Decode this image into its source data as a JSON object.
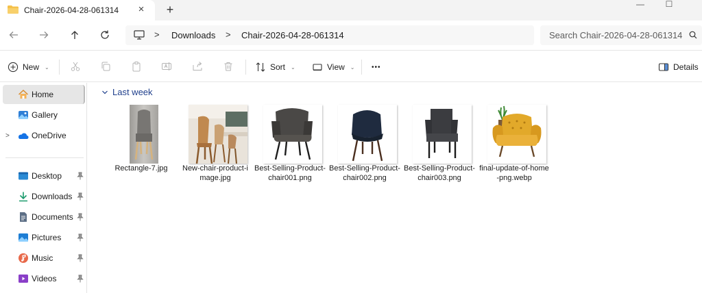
{
  "window": {
    "tab_title": "Chair-2026-04-28-061314",
    "tab_close": "×",
    "new_tab": "+",
    "minimize": "—",
    "maximize": "☐"
  },
  "address_bar": {
    "crumbs": [
      "Downloads",
      "Chair-2026-04-28-061314"
    ],
    "separator": ">"
  },
  "search": {
    "placeholder": "Search Chair-2026-04-28-061314"
  },
  "commands": {
    "new_label": "New",
    "sort_label": "Sort",
    "view_label": "View",
    "more_label": "•••",
    "details_label": "Details",
    "chevron": "⌄"
  },
  "sidebar": {
    "items": [
      {
        "label": "Home",
        "icon": "home-icon"
      },
      {
        "label": "Gallery",
        "icon": "gallery-icon"
      },
      {
        "label": "OneDrive",
        "icon": "onedrive-icon",
        "expander": ">"
      },
      {
        "label": "Desktop",
        "icon": "desktop-icon",
        "pinned": true
      },
      {
        "label": "Downloads",
        "icon": "downloads-icon",
        "pinned": true
      },
      {
        "label": "Documents",
        "icon": "documents-icon",
        "pinned": true
      },
      {
        "label": "Pictures",
        "icon": "pictures-icon",
        "pinned": true
      },
      {
        "label": "Music",
        "icon": "music-icon",
        "pinned": true
      },
      {
        "label": "Videos",
        "icon": "videos-icon",
        "pinned": true
      }
    ]
  },
  "content": {
    "group_label": "Last week",
    "files": [
      {
        "name": "Rectangle-7.jpg",
        "color": "#8b8b88"
      },
      {
        "name": "New-chair-product-image.jpg",
        "color": "#c0894f"
      },
      {
        "name": "Best-Selling-Product-chair001.png",
        "color": "#4a4846"
      },
      {
        "name": "Best-Selling-Product-chair002.png",
        "color": "#1f2b3f"
      },
      {
        "name": "Best-Selling-Product-chair003.png",
        "color": "#3b3c40"
      },
      {
        "name": "final-update-of-home-png.webp",
        "color": "#e2a92a"
      }
    ]
  },
  "colors": {
    "accent": "#1f3f8c",
    "selection": "#e6e6e6"
  }
}
